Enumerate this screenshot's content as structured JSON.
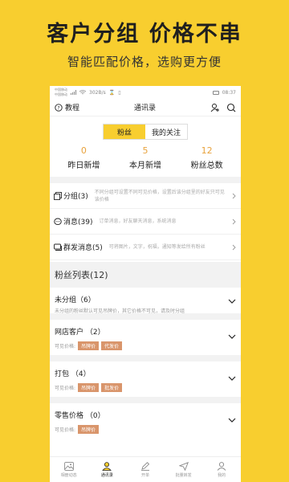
{
  "promo": {
    "title": "客户分组  价格不串",
    "subtitle": "智能匹配价格，选购更方便"
  },
  "statusbar": {
    "carrier_line1": "中国移动",
    "carrier_line2": "中国移动",
    "speed": "302B/s",
    "time": "08:37"
  },
  "nav": {
    "tutorial_label": "教程",
    "title": "通讯录"
  },
  "toggle": {
    "fans": "粉丝",
    "following": "我的关注"
  },
  "stats": [
    {
      "num": "0",
      "label": "昨日新增"
    },
    {
      "num": "5",
      "label": "本月新增"
    },
    {
      "num": "12",
      "label": "粉丝总数"
    }
  ],
  "menu": [
    {
      "label": "分组(3)",
      "desc": "不同分组可设置不同可见价格，设置后该分组里的好友只可见该价格"
    },
    {
      "label": "消息(39)",
      "desc": "订单消息，好友聊天消息，系统消息"
    },
    {
      "label": "群发消息(5)",
      "desc": "可将图片，文字，祝福，通知等发给所有粉丝"
    }
  ],
  "fan_list": {
    "title": "粉丝列表",
    "count": "(12)"
  },
  "groups": [
    {
      "name": "未分组（6）",
      "desc": "未分组的粉丝默认可见吊牌价，其它价格不可见，请及时分组"
    },
    {
      "name": "网店客户 （2）",
      "prices_label": "可见价格:",
      "tags": [
        "吊牌价",
        "代发价"
      ]
    },
    {
      "name": "打包 （4）",
      "prices_label": "可见价格:",
      "tags": [
        "吊牌价",
        "批发价"
      ]
    },
    {
      "name": "零售价格 （0）",
      "prices_label": "可见价格:",
      "tags": [
        "吊牌价"
      ]
    }
  ],
  "tabs": [
    {
      "label": "相册动态",
      "icon": "image-icon"
    },
    {
      "label": "通讯录",
      "icon": "contacts-icon"
    },
    {
      "label": "开单",
      "icon": "pen-icon"
    },
    {
      "label": "批量转发",
      "icon": "send-icon"
    },
    {
      "label": "我的",
      "icon": "user-icon"
    }
  ],
  "colors": {
    "brand_yellow": "#F8CE2F",
    "stat_orange": "#E8A23C",
    "tag_bg": "#D9956B"
  }
}
